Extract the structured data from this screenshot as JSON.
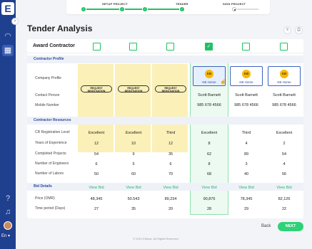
{
  "sidebar": {
    "logo": "E",
    "collapse_glyph": "›",
    "icons": [
      "dashboard-icon",
      "building-icon",
      "help-icon",
      "bell-icon"
    ],
    "language": "En ▾"
  },
  "stepper": {
    "steps": [
      {
        "label": "SETUP PROJECT",
        "status": "done"
      },
      {
        "label": "TENDER",
        "status": "done"
      },
      {
        "label": "SIGN PROJECT",
        "status": "current"
      }
    ],
    "check": "✓"
  },
  "header": {
    "title": "Tender Analysis",
    "filter_glyph": "≡",
    "print_glyph": "⎙"
  },
  "award": {
    "label": "Award Contractor",
    "selected_index": 3,
    "check": "✓"
  },
  "sections": {
    "profile": "Contractor Profile",
    "resources": "Contractor Resources",
    "bid": "Bid Details"
  },
  "labels": {
    "company_profile": "Company Profile",
    "contact_person": "Contact Person",
    "mobile_number": "Mobile Number",
    "cr_level": "CR Registration Level",
    "experience": "Years of Experience",
    "completed": "Completed Projects",
    "engineers": "Number of Engineers",
    "labors": "Number of Labors",
    "price": "Price (OMR)",
    "period": "Time period (Days)"
  },
  "request_label": "REQUEST NEGOTIATION",
  "contractors": [
    {
      "type": "request",
      "cr": "Excellent",
      "experience": "12",
      "completed": "54",
      "engineers": "6",
      "labors": "50",
      "view_bid": "View Bid",
      "price": "48,345",
      "period": "27"
    },
    {
      "type": "request",
      "cr": "Excellent",
      "experience": "10",
      "completed": "9",
      "engineers": "5",
      "labors": "60",
      "view_bid": "View Bid",
      "price": "50.543",
      "period": "35"
    },
    {
      "type": "request",
      "cr": "Third",
      "experience": "12",
      "completed": "35",
      "engineers": "6",
      "labors": "70",
      "view_bid": "View Bid",
      "price": "89,234",
      "period": "20"
    },
    {
      "type": "company",
      "logo": "KB",
      "company": "KB Home",
      "contact": "Scott Barnett",
      "mobile": "985 678 4566",
      "cr": "Excellent",
      "experience": "8",
      "completed": "62",
      "engineers": "8",
      "labors": "68",
      "view_bid": "View Bid",
      "price": "90,876",
      "period": "28"
    },
    {
      "type": "company",
      "logo": "KB",
      "company": "KB Home",
      "contact": "Scott Barnett",
      "mobile": "985 678 4566",
      "cr": "Third",
      "experience": "4",
      "completed": "89",
      "engineers": "3",
      "labors": "40",
      "view_bid": "View Bid",
      "price": "78,345",
      "period": "29"
    },
    {
      "type": "company",
      "logo": "KB",
      "company": "KB Home",
      "contact": "Scott Barnett",
      "mobile": "985 678 4566",
      "cr": "Excellent",
      "experience": "2",
      "completed": "54",
      "engineers": "4",
      "labors": "56",
      "view_bid": "View Bid",
      "price": "82,126",
      "period": "22"
    }
  ],
  "footer": {
    "copyright": "© 2021 Eltimar. All Rights Reserved.",
    "back": "Back",
    "next": "NEXT"
  },
  "colors": {
    "sidebar": "#1f3f8f",
    "accent_green": "#20c165",
    "request_bg": "#fbf0b8",
    "selected_bg": "#edfaf1"
  }
}
